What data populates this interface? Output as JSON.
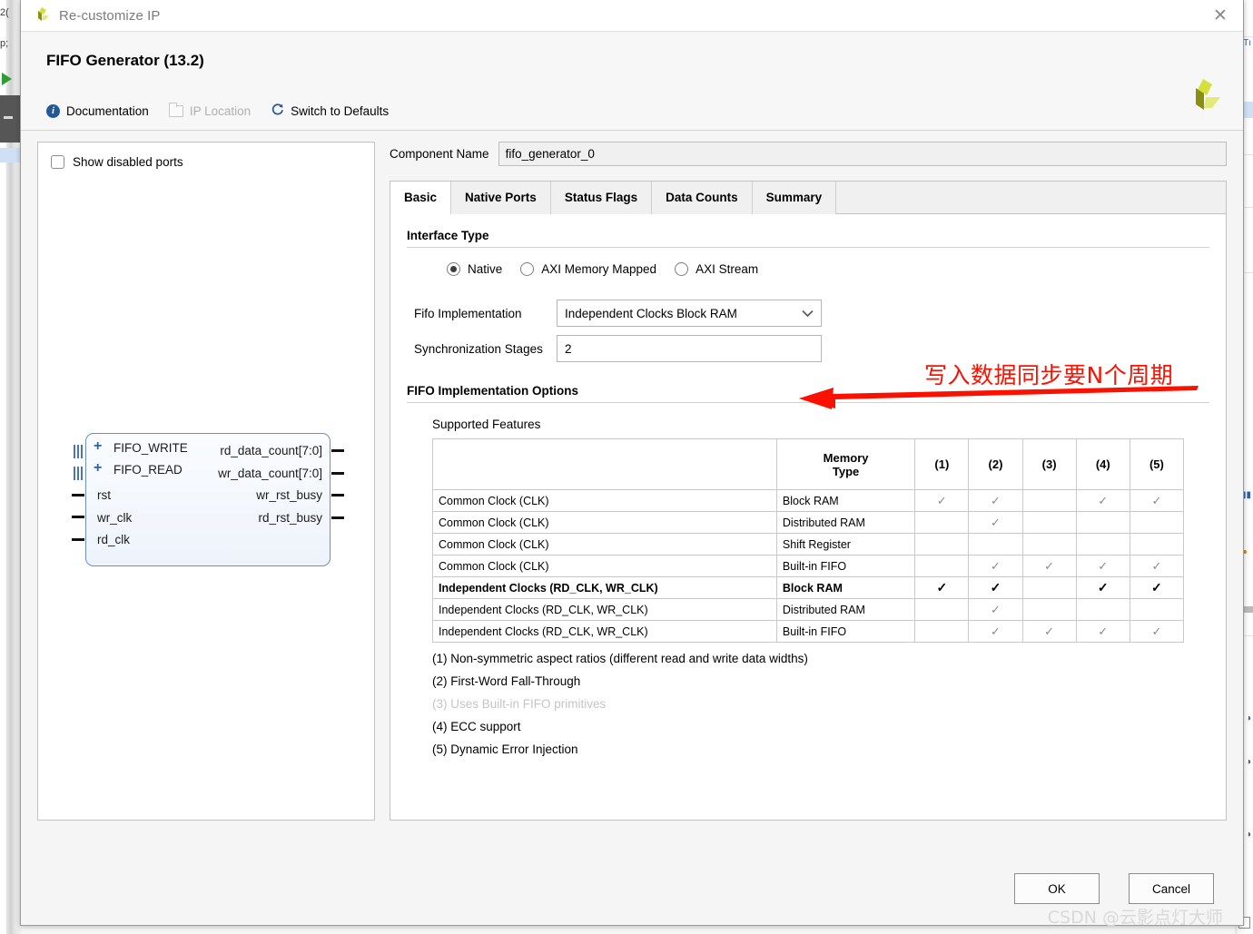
{
  "window": {
    "title": "Re-customize IP",
    "close_label": "✕",
    "logo_name": "xilinx-logo"
  },
  "header": {
    "ip_title": "FIFO Generator (13.2)",
    "tools": [
      {
        "label": "Documentation",
        "icon": "info-icon",
        "disabled": false
      },
      {
        "label": "IP Location",
        "icon": "folder-icon",
        "disabled": true
      },
      {
        "label": "Switch to Defaults",
        "icon": "refresh-icon",
        "disabled": false
      }
    ]
  },
  "left_panel": {
    "show_disabled_ports": {
      "label": "Show disabled ports",
      "checked": false
    },
    "symbol": {
      "bus_ports": [
        "FIFO_WRITE",
        "FIFO_READ"
      ],
      "input_ports": [
        "rst",
        "wr_clk",
        "rd_clk"
      ],
      "output_ports": [
        "rd_data_count[7:0]",
        "wr_data_count[7:0]",
        "wr_rst_busy",
        "rd_rst_busy"
      ]
    }
  },
  "component_name": {
    "label": "Component Name",
    "value": "fifo_generator_0"
  },
  "tabs": [
    {
      "label": "Basic",
      "active": true
    },
    {
      "label": "Native Ports",
      "active": false
    },
    {
      "label": "Status Flags",
      "active": false
    },
    {
      "label": "Data Counts",
      "active": false
    },
    {
      "label": "Summary",
      "active": false
    }
  ],
  "interface_type": {
    "section_title": "Interface Type",
    "options": [
      {
        "label": "Native",
        "selected": true
      },
      {
        "label": "AXI Memory Mapped",
        "selected": false
      },
      {
        "label": "AXI Stream",
        "selected": false
      }
    ]
  },
  "fields": {
    "fifo_implementation": {
      "label": "Fifo Implementation",
      "value": "Independent Clocks Block RAM",
      "chevron": "⌄"
    },
    "synchronization_stages": {
      "label": "Synchronization Stages",
      "value": "2"
    }
  },
  "implementation_options": {
    "section_title": "FIFO Implementation Options",
    "supported_features_label": "Supported Features"
  },
  "feature_table": {
    "headers": [
      "",
      "Memory\nType",
      "(1)",
      "(2)",
      "(3)",
      "(4)",
      "(5)"
    ],
    "header_blank": "",
    "header_memory_line1": "Memory",
    "header_memory_line2": "Type",
    "header_cols": [
      "(1)",
      "(2)",
      "(3)",
      "(4)",
      "(5)"
    ],
    "check_mark": "✓",
    "rows": [
      {
        "feature": "Common Clock (CLK)",
        "memory": "Block RAM",
        "marks": [
          true,
          true,
          false,
          true,
          true
        ],
        "highlighted": false
      },
      {
        "feature": "Common Clock (CLK)",
        "memory": "Distributed RAM",
        "marks": [
          false,
          true,
          false,
          false,
          false
        ],
        "highlighted": false
      },
      {
        "feature": "Common Clock (CLK)",
        "memory": "Shift Register",
        "marks": [
          false,
          false,
          false,
          false,
          false
        ],
        "highlighted": false
      },
      {
        "feature": "Common Clock (CLK)",
        "memory": "Built-in FIFO",
        "marks": [
          false,
          true,
          true,
          true,
          true
        ],
        "highlighted": false
      },
      {
        "feature": "Independent Clocks (RD_CLK, WR_CLK)",
        "memory": "Block RAM",
        "marks": [
          true,
          true,
          false,
          true,
          true
        ],
        "highlighted": true
      },
      {
        "feature": "Independent Clocks (RD_CLK, WR_CLK)",
        "memory": "Distributed RAM",
        "marks": [
          false,
          true,
          false,
          false,
          false
        ],
        "highlighted": false
      },
      {
        "feature": "Independent Clocks (RD_CLK, WR_CLK)",
        "memory": "Built-in FIFO",
        "marks": [
          false,
          true,
          true,
          true,
          true
        ],
        "highlighted": false
      }
    ]
  },
  "footnotes": [
    {
      "text": "(1) Non-symmetric aspect ratios (different read and write data widths)",
      "muted": false
    },
    {
      "text": "(2) First-Word Fall-Through",
      "muted": false
    },
    {
      "text": "(3) Uses Built-in FIFO primitives",
      "muted": true
    },
    {
      "text": "(4) ECC support",
      "muted": false
    },
    {
      "text": "(5) Dynamic Error Injection",
      "muted": false
    }
  ],
  "annotation": {
    "text": "写入数据同步要N个周期",
    "color": "#fb1100"
  },
  "footer": {
    "ok_label": "OK",
    "cancel_label": "Cancel",
    "watermark": "CSDN @云影点灯大师"
  },
  "background": {
    "left_fragments": [
      "2(",
      "p;"
    ],
    "right_glyphs": [
      "Tı",
      "▮▮",
      "◑",
      "◑",
      "◑"
    ]
  }
}
